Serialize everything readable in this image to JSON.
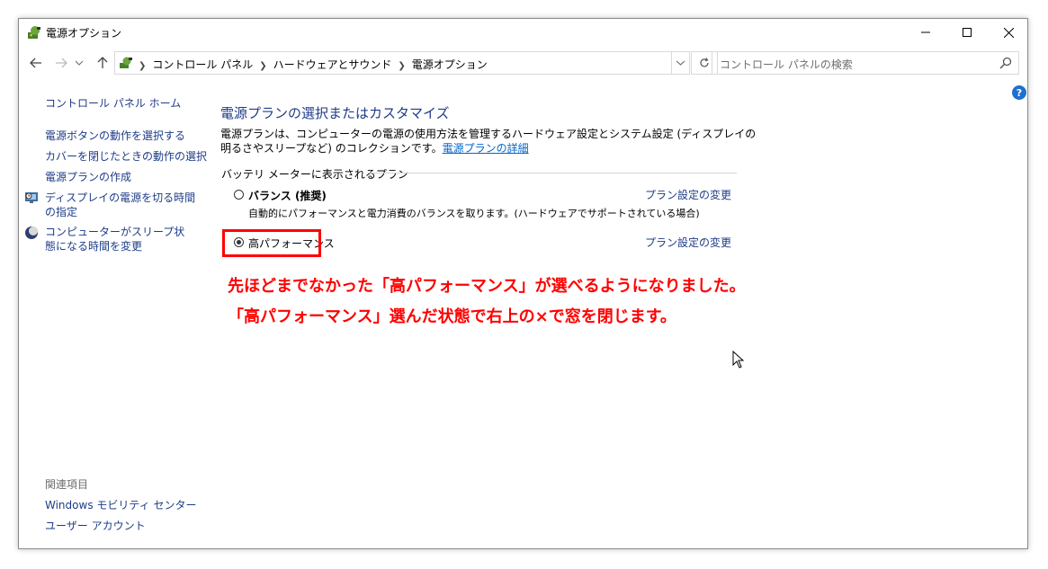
{
  "window": {
    "title": "電源オプション"
  },
  "nav": {
    "breadcrumbs": [
      "コントロール パネル",
      "ハードウェアとサウンド",
      "電源オプション"
    ],
    "search_placeholder": "コントロール パネルの検索"
  },
  "sidebar": {
    "home": "コントロール パネル ホーム",
    "items": [
      "電源ボタンの動作を選択する",
      "カバーを閉じたときの動作の選択",
      "電源プランの作成",
      "ディスプレイの電源を切る時間の指定",
      "コンピューターがスリープ状態になる時間を変更"
    ],
    "related_title": "関連項目",
    "related": [
      "Windows モビリティ センター",
      "ユーザー アカウント"
    ]
  },
  "main": {
    "heading": "電源プランの選択またはカスタマイズ",
    "description": "電源プランは、コンピューターの電源の使用方法を管理するハードウェア設定とシステム設定 (ディスプレイの明るさやスリープなど) のコレクションです。",
    "description_link": "電源プランの詳細",
    "group_label": "バッテリ メーターに表示されるプラン",
    "plans": [
      {
        "name": "バランス (推奨)",
        "selected": false,
        "desc": "自動的にパフォーマンスと電力消費のバランスを取ります。(ハードウェアでサポートされている場合)",
        "link": "プラン設定の変更"
      },
      {
        "name": "高パフォーマンス",
        "selected": true,
        "desc": "",
        "link": "プラン設定の変更"
      }
    ]
  },
  "annotation": {
    "line1": "先ほどまでなかった「高パフォーマンス」が選べるようになりました。",
    "line2": "「高パフォーマンス」選んだ状態で右上の×で窓を閉じます。",
    "color": "#ff0000"
  }
}
